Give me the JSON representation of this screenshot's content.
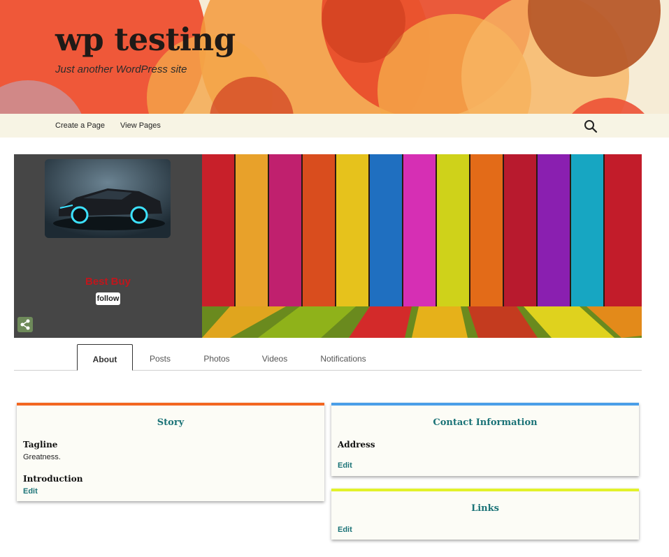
{
  "header": {
    "site_title": "wp testing",
    "site_description": "Just another WordPress site"
  },
  "nav": {
    "items": [
      {
        "label": "Create a Page"
      },
      {
        "label": "View Pages"
      }
    ],
    "search_icon": "search-icon"
  },
  "profile": {
    "page_name": "Best Buy",
    "follow_label": "follow",
    "share_icon": "share-icon",
    "name_color": "#c0161c"
  },
  "tabs": [
    {
      "label": "About",
      "active": true
    },
    {
      "label": "Posts",
      "active": false
    },
    {
      "label": "Photos",
      "active": false
    },
    {
      "label": "Videos",
      "active": false
    },
    {
      "label": "Notifications",
      "active": false
    }
  ],
  "cards": {
    "story": {
      "title": "Story",
      "accent": "#f26722",
      "tagline_label": "Tagline",
      "tagline_value": "Greatness.",
      "intro_label": "Introduction",
      "edit_label": "Edit"
    },
    "contact": {
      "title": "Contact Information",
      "accent": "#4a9fe8",
      "address_label": "Address",
      "edit_label": "Edit"
    },
    "links": {
      "title": "Links",
      "accent": "#e2f22a",
      "edit_label": "Edit"
    }
  }
}
